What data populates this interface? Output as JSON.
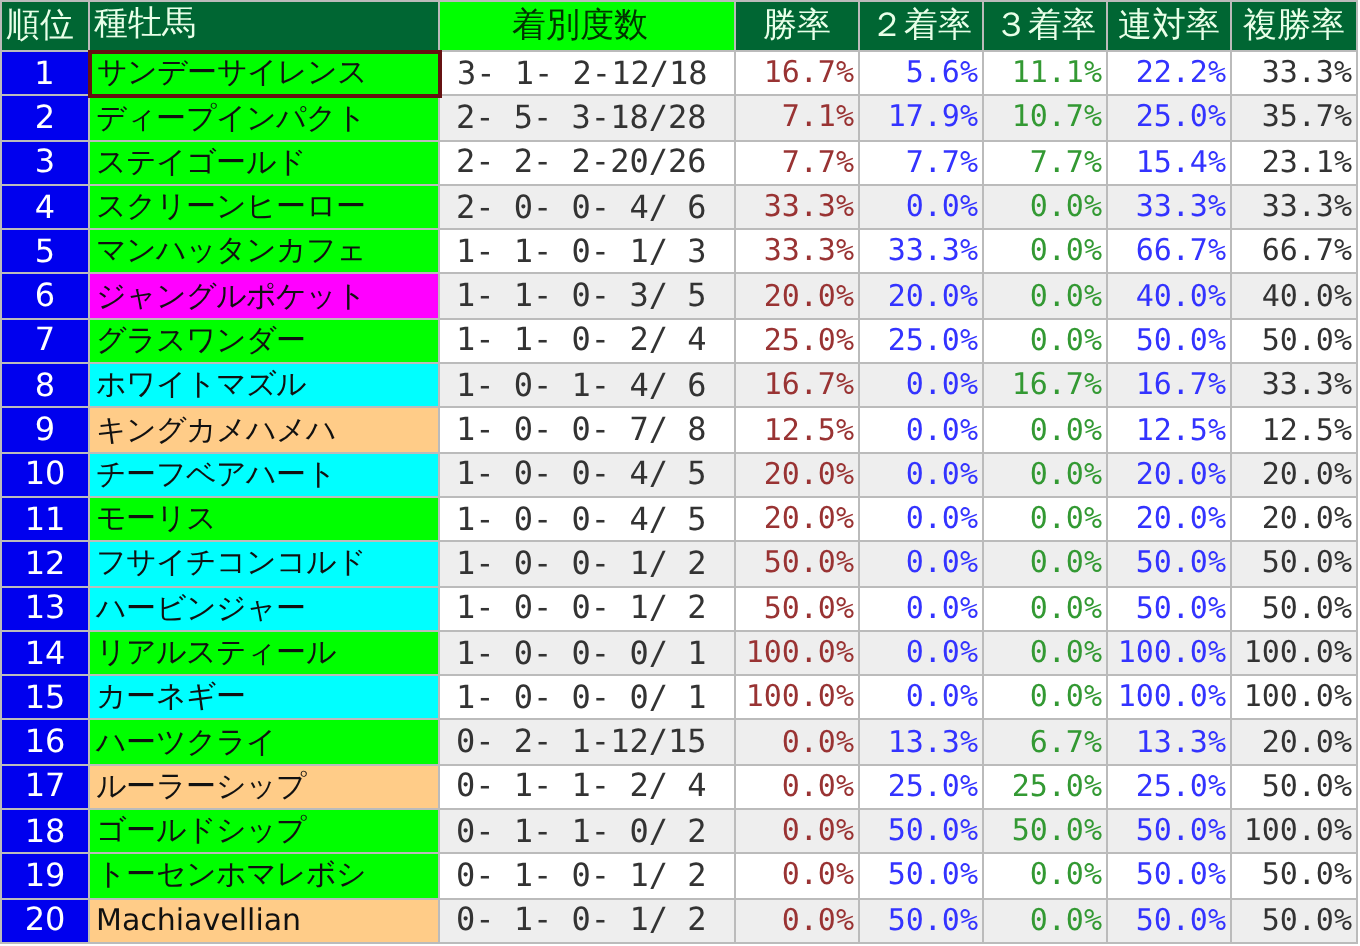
{
  "table": {
    "columns": [
      {
        "label": "順位",
        "highlight": false
      },
      {
        "label": "種牡馬",
        "highlight": false
      },
      {
        "label": "着別度数",
        "highlight": true
      },
      {
        "label": "勝率",
        "highlight": false
      },
      {
        "label": "２着率",
        "highlight": false
      },
      {
        "label": "３着率",
        "highlight": false
      },
      {
        "label": "連対率",
        "highlight": false
      },
      {
        "label": "複勝率",
        "highlight": false
      }
    ],
    "rows": [
      {
        "rank": "1",
        "name": "サンデーサイレンス",
        "color": "#00ff00",
        "selected": true,
        "record": "3- 1- 2-12/18",
        "rates": [
          "16.7%",
          "5.6%",
          "11.1%",
          "22.2%",
          "33.3%"
        ]
      },
      {
        "rank": "2",
        "name": "ディープインパクト",
        "color": "#00ff00",
        "selected": false,
        "record": "2- 5- 3-18/28",
        "rates": [
          "7.1%",
          "17.9%",
          "10.7%",
          "25.0%",
          "35.7%"
        ]
      },
      {
        "rank": "3",
        "name": "ステイゴールド",
        "color": "#00ff00",
        "selected": false,
        "record": "2- 2- 2-20/26",
        "rates": [
          "7.7%",
          "7.7%",
          "7.7%",
          "15.4%",
          "23.1%"
        ]
      },
      {
        "rank": "4",
        "name": "スクリーンヒーロー",
        "color": "#00ff00",
        "selected": false,
        "record": "2- 0- 0- 4/ 6",
        "rates": [
          "33.3%",
          "0.0%",
          "0.0%",
          "33.3%",
          "33.3%"
        ]
      },
      {
        "rank": "5",
        "name": "マンハッタンカフェ",
        "color": "#00ff00",
        "selected": false,
        "record": "1- 1- 0- 1/ 3",
        "rates": [
          "33.3%",
          "33.3%",
          "0.0%",
          "66.7%",
          "66.7%"
        ]
      },
      {
        "rank": "6",
        "name": "ジャングルポケット",
        "color": "#ff00ff",
        "selected": false,
        "record": "1- 1- 0- 3/ 5",
        "rates": [
          "20.0%",
          "20.0%",
          "0.0%",
          "40.0%",
          "40.0%"
        ]
      },
      {
        "rank": "7",
        "name": "グラスワンダー",
        "color": "#00ff00",
        "selected": false,
        "record": "1- 1- 0- 2/ 4",
        "rates": [
          "25.0%",
          "25.0%",
          "0.0%",
          "50.0%",
          "50.0%"
        ]
      },
      {
        "rank": "8",
        "name": "ホワイトマズル",
        "color": "#00ffff",
        "selected": false,
        "record": "1- 0- 1- 4/ 6",
        "rates": [
          "16.7%",
          "0.0%",
          "16.7%",
          "16.7%",
          "33.3%"
        ]
      },
      {
        "rank": "9",
        "name": "キングカメハメハ",
        "color": "#ffcc88",
        "selected": false,
        "record": "1- 0- 0- 7/ 8",
        "rates": [
          "12.5%",
          "0.0%",
          "0.0%",
          "12.5%",
          "12.5%"
        ]
      },
      {
        "rank": "10",
        "name": "チーフベアハート",
        "color": "#00ffff",
        "selected": false,
        "record": "1- 0- 0- 4/ 5",
        "rates": [
          "20.0%",
          "0.0%",
          "0.0%",
          "20.0%",
          "20.0%"
        ]
      },
      {
        "rank": "11",
        "name": "モーリス",
        "color": "#00ff00",
        "selected": false,
        "record": "1- 0- 0- 4/ 5",
        "rates": [
          "20.0%",
          "0.0%",
          "0.0%",
          "20.0%",
          "20.0%"
        ]
      },
      {
        "rank": "12",
        "name": "フサイチコンコルド",
        "color": "#00ffff",
        "selected": false,
        "record": "1- 0- 0- 1/ 2",
        "rates": [
          "50.0%",
          "0.0%",
          "0.0%",
          "50.0%",
          "50.0%"
        ]
      },
      {
        "rank": "13",
        "name": "ハービンジャー",
        "color": "#00ffff",
        "selected": false,
        "record": "1- 0- 0- 1/ 2",
        "rates": [
          "50.0%",
          "0.0%",
          "0.0%",
          "50.0%",
          "50.0%"
        ]
      },
      {
        "rank": "14",
        "name": "リアルスティール",
        "color": "#00ff00",
        "selected": false,
        "record": "1- 0- 0- 0/ 1",
        "rates": [
          "100.0%",
          "0.0%",
          "0.0%",
          "100.0%",
          "100.0%"
        ]
      },
      {
        "rank": "15",
        "name": "カーネギー",
        "color": "#00ffff",
        "selected": false,
        "record": "1- 0- 0- 0/ 1",
        "rates": [
          "100.0%",
          "0.0%",
          "0.0%",
          "100.0%",
          "100.0%"
        ]
      },
      {
        "rank": "16",
        "name": "ハーツクライ",
        "color": "#00ff00",
        "selected": false,
        "record": "0- 2- 1-12/15",
        "rates": [
          "0.0%",
          "13.3%",
          "6.7%",
          "13.3%",
          "20.0%"
        ]
      },
      {
        "rank": "17",
        "name": "ルーラーシップ",
        "color": "#ffcc88",
        "selected": false,
        "record": "0- 1- 1- 2/ 4",
        "rates": [
          "0.0%",
          "25.0%",
          "25.0%",
          "25.0%",
          "50.0%"
        ]
      },
      {
        "rank": "18",
        "name": "ゴールドシップ",
        "color": "#00ff00",
        "selected": false,
        "record": "0- 1- 1- 0/ 2",
        "rates": [
          "0.0%",
          "50.0%",
          "50.0%",
          "50.0%",
          "100.0%"
        ]
      },
      {
        "rank": "19",
        "name": "トーセンホマレボシ",
        "color": "#00ff00",
        "selected": false,
        "record": "0- 1- 0- 1/ 2",
        "rates": [
          "0.0%",
          "50.0%",
          "0.0%",
          "50.0%",
          "50.0%"
        ]
      },
      {
        "rank": "20",
        "name": "Machiavellian",
        "color": "#ffcc88",
        "selected": false,
        "record": "0- 1- 0- 1/ 2",
        "rates": [
          "0.0%",
          "50.0%",
          "0.0%",
          "50.0%",
          "50.0%"
        ]
      }
    ]
  }
}
